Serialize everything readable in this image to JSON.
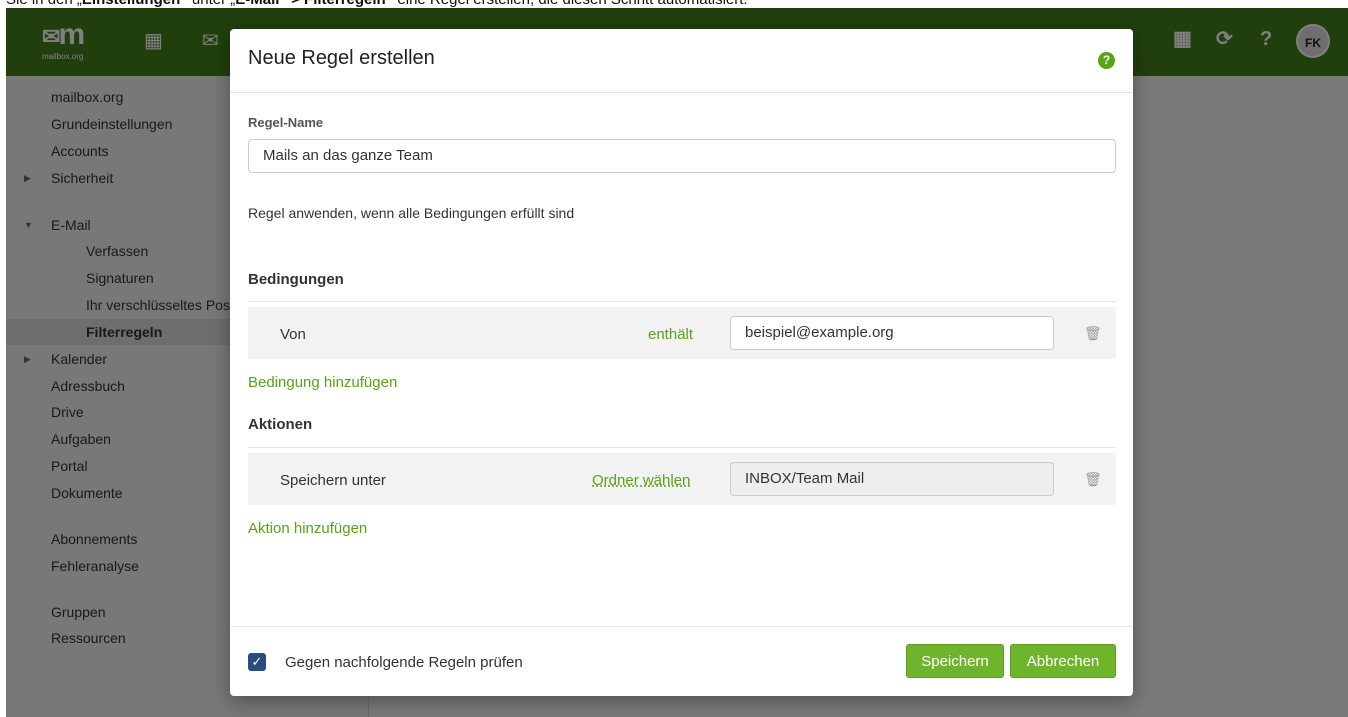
{
  "caption": {
    "prefix": "Sie in den „",
    "bold1": "Einstellungen“",
    "mid": " unter „",
    "bold2": "E-Mail“ > Filterregeln“",
    "suffix": " eine Regel erstellen, die diesen Schritt automatisiert."
  },
  "topbar": {
    "logo_mark": "m",
    "logo_sub": "mailbox.org",
    "avatar": "FK",
    "right_icons": [
      "apps-grid-icon",
      "refresh-icon",
      "help-icon"
    ]
  },
  "sidebar": {
    "items": [
      {
        "label": "mailbox.org"
      },
      {
        "label": "Grundeinstellungen"
      },
      {
        "label": "Accounts"
      },
      {
        "label": "Sicherheit"
      },
      {
        "label": "E-Mail"
      },
      {
        "label": "Verfassen"
      },
      {
        "label": "Signaturen"
      },
      {
        "label": "Ihr verschlüsseltes Pos"
      },
      {
        "label": "Filterregeln"
      },
      {
        "label": "Kalender"
      },
      {
        "label": "Adressbuch"
      },
      {
        "label": "Drive"
      },
      {
        "label": "Aufgaben"
      },
      {
        "label": "Portal"
      },
      {
        "label": "Dokumente"
      },
      {
        "label": "Abonnements"
      },
      {
        "label": "Fehleranalyse"
      },
      {
        "label": "Gruppen"
      },
      {
        "label": "Ressourcen"
      }
    ]
  },
  "dialog": {
    "title": "Neue Regel erstellen",
    "rule_name_label": "Regel-Name",
    "rule_name_value": "Mails an das ganze Team",
    "apply_text": "Regel anwenden, wenn alle Bedingungen erfüllt sind",
    "conditions_heading": "Bedingungen",
    "condition": {
      "field": "Von",
      "operator": "enthält",
      "value": "beispiel@example.org"
    },
    "add_condition": "Bedingung hinzufügen",
    "actions_heading": "Aktionen",
    "action": {
      "type": "Speichern unter",
      "choose": "Ordner wählen",
      "value": "INBOX/Team Mail"
    },
    "add_action": "Aktion hinzufügen",
    "check_following_label": "Gegen nachfolgende Regeln prüfen",
    "check_following_checked": true,
    "save_label": "Speichern",
    "cancel_label": "Abbrechen"
  },
  "colors": {
    "brand_green": "#437e1b",
    "accent_green": "#6fb52c",
    "checkbox": "#2b4c7e"
  }
}
